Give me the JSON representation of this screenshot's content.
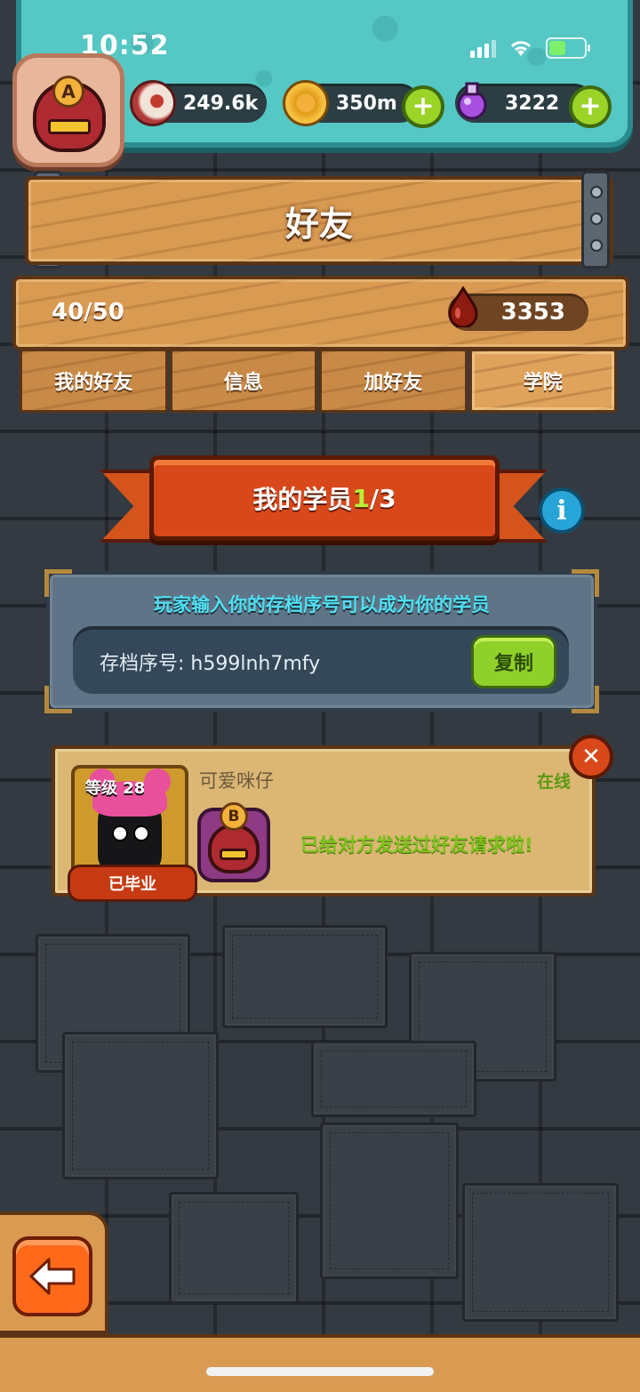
{
  "status_bar": {
    "time": "10:52"
  },
  "player": {
    "rank_letter": "A"
  },
  "resources": [
    {
      "icon": "eyeball-icon",
      "value": "249.6k"
    },
    {
      "icon": "gold-coin-icon",
      "value": "350m"
    },
    {
      "icon": "potion-icon",
      "value": "3222"
    }
  ],
  "header": {
    "title": "好友"
  },
  "friends": {
    "count": "40/50",
    "blood_value": "3353"
  },
  "tabs": [
    {
      "label": "我的好友",
      "active": false
    },
    {
      "label": "信息",
      "active": false
    },
    {
      "label": "加好友",
      "active": false
    },
    {
      "label": "学院",
      "active": true
    }
  ],
  "banner": {
    "label": "我的学员 ",
    "current": "1",
    "total": "/3"
  },
  "invite": {
    "title": "玩家输入你的存档序号可以成为你的学员",
    "code_text": "存档序号: h599lnh7mfy",
    "copy_label": "复制"
  },
  "student": {
    "level_text": "等级 28",
    "name": "可爱咪仔",
    "status": "在线",
    "graduated_label": "已毕业",
    "rank_letter": "B",
    "message": "已给对方发送过好友请求啦!"
  },
  "colors": {
    "accent_green": "#9bd327",
    "ribbon_red": "#d9481a",
    "wood": "#d99a52",
    "teal": "#55c7c4"
  }
}
